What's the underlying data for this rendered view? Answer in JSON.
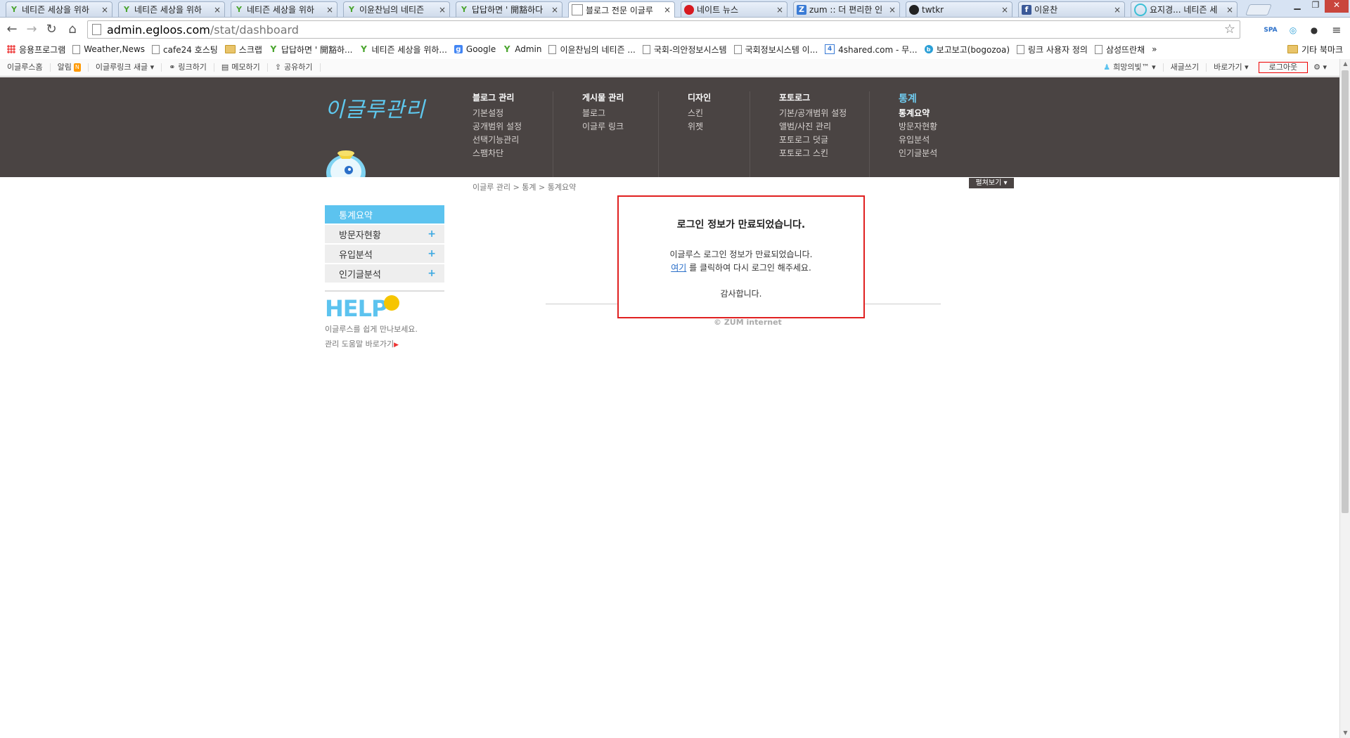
{
  "browser": {
    "tabs": [
      {
        "title": "네티즌 세상을 위하",
        "icon": "leaf-icon",
        "active": false
      },
      {
        "title": "네티즌 세상을 위하",
        "icon": "leaf-icon",
        "active": false
      },
      {
        "title": "네티즌 세상을 위하",
        "icon": "leaf-icon",
        "active": false
      },
      {
        "title": "이윤찬님의 네티즌",
        "icon": "leaf-icon",
        "active": false
      },
      {
        "title": "답답하면 ' 開豁하다",
        "icon": "leaf-icon",
        "active": false
      },
      {
        "title": "블로그 전문 이글루",
        "icon": "page-icon",
        "active": true
      },
      {
        "title": "네이트 뉴스",
        "icon": "nate-icon",
        "active": false
      },
      {
        "title": "zum :: 더 편리한 인",
        "icon": "zum-icon",
        "active": false
      },
      {
        "title": "twtkr",
        "icon": "twtkr-icon",
        "active": false
      },
      {
        "title": "이윤찬",
        "icon": "facebook-icon",
        "active": false
      },
      {
        "title": "요지경... 네티즌 세",
        "icon": "circle-icon",
        "active": false
      }
    ],
    "close_glyph": "×",
    "address": {
      "host": "admin.egloos.com",
      "path": "/stat/dashboard"
    },
    "bookmarks": [
      {
        "label": "응용프로그램",
        "icon": "apps"
      },
      {
        "label": "Weather,News",
        "icon": "page"
      },
      {
        "label": "cafe24 호스팅",
        "icon": "page"
      },
      {
        "label": "스크랩",
        "icon": "folder"
      },
      {
        "label": "답답하면 ' 開豁하...",
        "icon": "leaf"
      },
      {
        "label": "네티즌 세상을 위하...",
        "icon": "leaf"
      },
      {
        "label": "Google",
        "icon": "google"
      },
      {
        "label": "Admin",
        "icon": "leaf"
      },
      {
        "label": "이윤찬님의 네티즌 ...",
        "icon": "page"
      },
      {
        "label": "국회-의안정보시스템",
        "icon": "page"
      },
      {
        "label": "국회정보시스템 이...",
        "icon": "page"
      },
      {
        "label": "4shared.com - 무...",
        "icon": "four"
      },
      {
        "label": "보고보고(bogozoa)",
        "icon": "circ"
      },
      {
        "label": "링크 사용자 정의",
        "icon": "page"
      },
      {
        "label": "삼성뜨란채",
        "icon": "page"
      }
    ],
    "bookmarks_more": "»",
    "other_bookmarks": "기타 북마크"
  },
  "egloos_bar": {
    "left": [
      "이글루스홈",
      "알림",
      "이글루링크 새글 ▾",
      "링크하기",
      "메모하기",
      "공유하기"
    ],
    "rss": "N",
    "right": [
      "희망의빛™ ▾",
      "새글쓰기",
      "바로가기 ▾",
      "로그아웃"
    ]
  },
  "admin_header": {
    "logo": "이글루관리",
    "menus": [
      {
        "heading": "블로그 관리",
        "items": [
          "기본설정",
          "공개범위 설정",
          "선택기능관리",
          "스팸차단"
        ]
      },
      {
        "heading": "게시물 관리",
        "items": [
          "블로그",
          "이글루 링크"
        ]
      },
      {
        "heading": "디자인",
        "items": [
          "스킨",
          "위젯"
        ]
      },
      {
        "heading": "포토로그",
        "items": [
          "기본/공개범위 설정",
          "앨범/사진 관리",
          "포토로그 덧글",
          "포토로그 스킨"
        ]
      },
      {
        "heading": "통계",
        "items": [
          "통계요약",
          "방문자현황",
          "유입분석",
          "인기글분석"
        ]
      }
    ]
  },
  "breadcrumb": "이글루 관리 > 통계 > 통계요약",
  "expand_button": "펼쳐보기",
  "side_menu": [
    {
      "label": "통계요약",
      "active": true,
      "plus": ""
    },
    {
      "label": "방문자현황",
      "active": false,
      "plus": "+"
    },
    {
      "label": "유입분석",
      "active": false,
      "plus": "+"
    },
    {
      "label": "인기글분석",
      "active": false,
      "plus": "+"
    }
  ],
  "help": {
    "title": "HELP",
    "line1": "이글루스를 쉽게 만나보세요.",
    "line2": "관리 도움말 바로가기"
  },
  "message": {
    "title": "로그인 정보가 만료되었습니다.",
    "line1": "이글루스 로그인 정보가 만료되었습니다.",
    "link": "여기",
    "line2_rest": " 를 클릭하여 다시 로그인 해주세요.",
    "thanks": "감사합니다."
  },
  "footer": "© ZUM internet",
  "colors": {
    "header_bg": "#4a4443",
    "accent": "#5cc3ef",
    "highlight_border": "#e02020"
  }
}
